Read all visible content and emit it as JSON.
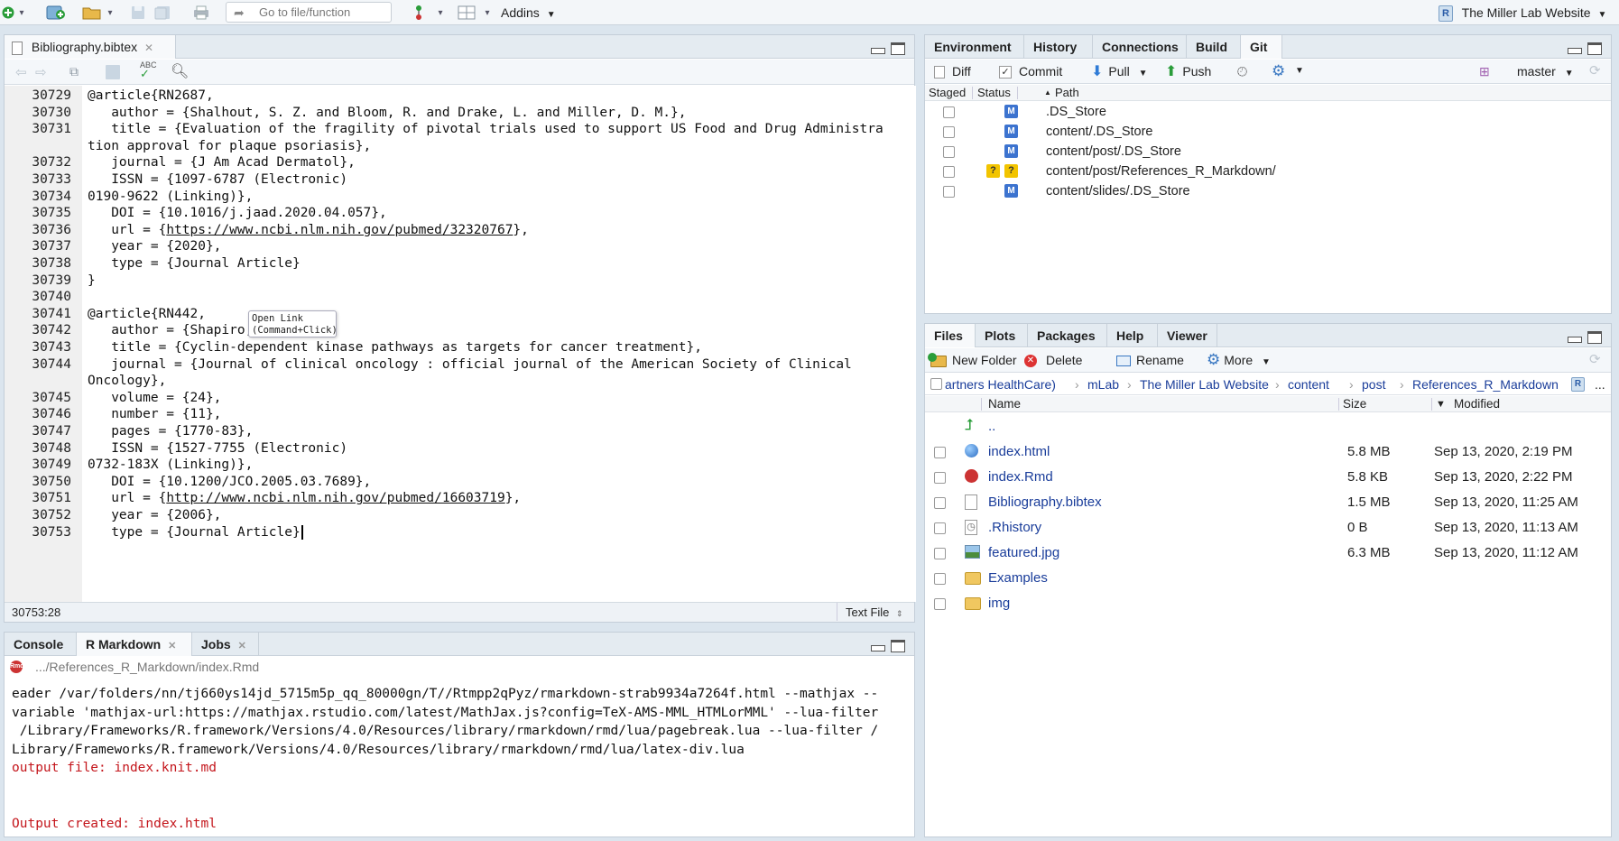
{
  "toolbar": {
    "goto_placeholder": "Go to file/function",
    "addins_label": "Addins",
    "project_label": "The Miller Lab Website"
  },
  "editor": {
    "tab_label": "Bibliography.bibtex",
    "lines": [
      {
        "num": "30729",
        "text": "@article{RN2687,"
      },
      {
        "num": "30730",
        "text": "   author = {Shalhout, S. Z. and Bloom, R. and Drake, L. and Miller, D. M.},"
      },
      {
        "num": "30731",
        "text": "   title = {Evaluation of the fragility of pivotal trials used to support US Food and Drug Administra"
      },
      {
        "num": "",
        "text": "tion approval for plaque psoriasis},"
      },
      {
        "num": "30732",
        "text": "   journal = {J Am Acad Dermatol},"
      },
      {
        "num": "30733",
        "text": "   ISSN = {1097-6787 (Electronic)"
      },
      {
        "num": "30734",
        "text": "0190-9622 (Linking)},"
      },
      {
        "num": "30735",
        "text": "   DOI = {10.1016/j.jaad.2020.04.057},"
      },
      {
        "num": "30736",
        "pre": "   url = {",
        "link": "https://www.ncbi.nlm.nih.gov/pubmed/32320767",
        "post": "},"
      },
      {
        "num": "30737",
        "text": "   year = {2020},"
      },
      {
        "num": "30738",
        "text": "   type = {Journal Article}"
      },
      {
        "num": "30739",
        "text": "}"
      },
      {
        "num": "30740",
        "text": ""
      },
      {
        "num": "30741",
        "text": "@article{RN442,"
      },
      {
        "num": "30742",
        "text": "   author = {Shapiro, G. I.},"
      },
      {
        "num": "30743",
        "text": "   title = {Cyclin-dependent kinase pathways as targets for cancer treatment},"
      },
      {
        "num": "30744",
        "text": "   journal = {Journal of clinical oncology : official journal of the American Society of Clinical"
      },
      {
        "num": "",
        "text": "Oncology},"
      },
      {
        "num": "30745",
        "text": "   volume = {24},"
      },
      {
        "num": "30746",
        "text": "   number = {11},"
      },
      {
        "num": "30747",
        "text": "   pages = {1770-83},"
      },
      {
        "num": "30748",
        "text": "   ISSN = {1527-7755 (Electronic)"
      },
      {
        "num": "30749",
        "text": "0732-183X (Linking)},"
      },
      {
        "num": "30750",
        "text": "   DOI = {10.1200/JCO.2005.03.7689},"
      },
      {
        "num": "30751",
        "pre": "   url = {",
        "link": "http://www.ncbi.nlm.nih.gov/pubmed/16603719",
        "post": "},"
      },
      {
        "num": "30752",
        "text": "   year = {2006},"
      },
      {
        "num": "30753",
        "text": "   type = {Journal Article}"
      }
    ],
    "tooltip_line1": "Open Link",
    "tooltip_line2": "(Command+Click)",
    "cursor_pos": "30753:28",
    "file_type": "Text File"
  },
  "console": {
    "tabs": [
      "Console",
      "R Markdown",
      "Jobs"
    ],
    "path": ".../References_R_Markdown/index.Rmd",
    "lines": [
      {
        "text": "eader /var/folders/nn/tj660ys14jd_5715m5p_qq_80000gn/T//Rtmpp2qPyz/rmarkdown-strab9934a7264f.html --mathjax --",
        "red": false
      },
      {
        "text": "variable 'mathjax-url:https://mathjax.rstudio.com/latest/MathJax.js?config=TeX-AMS-MML_HTMLorMML' --lua-filter",
        "red": false
      },
      {
        "text": " /Library/Frameworks/R.framework/Versions/4.0/Resources/library/rmarkdown/rmd/lua/pagebreak.lua --lua-filter /",
        "red": false
      },
      {
        "text": "Library/Frameworks/R.framework/Versions/4.0/Resources/library/rmarkdown/rmd/lua/latex-div.lua",
        "red": false
      },
      {
        "text": "output file: index.knit.md",
        "red": true
      },
      {
        "text": "",
        "red": false
      },
      {
        "text": "",
        "red": false
      },
      {
        "text": "Output created: index.html",
        "red": true
      }
    ]
  },
  "env": {
    "tabs": [
      "Environment",
      "History",
      "Connections",
      "Build",
      "Git"
    ],
    "buttons": {
      "diff": "Diff",
      "commit": "Commit",
      "pull": "Pull",
      "push": "Push",
      "branch": "master"
    },
    "headers": {
      "staged": "Staged",
      "status": "Status",
      "path": "Path"
    },
    "rows": [
      {
        "status": "M",
        "path": ".DS_Store"
      },
      {
        "status": "M",
        "path": "content/.DS_Store"
      },
      {
        "status": "M",
        "path": "content/post/.DS_Store"
      },
      {
        "status": "?",
        "path": "content/post/References_R_Markdown/"
      },
      {
        "status": "M",
        "path": "content/slides/.DS_Store"
      }
    ]
  },
  "files": {
    "tabs": [
      "Files",
      "Plots",
      "Packages",
      "Help",
      "Viewer"
    ],
    "buttons": {
      "new_folder": "New Folder",
      "delete": "Delete",
      "rename": "Rename",
      "more": "More"
    },
    "breadcrumbs": [
      "artners HealthCare)",
      "mLab",
      "The Miller Lab Website",
      "content",
      "post",
      "References_R_Markdown"
    ],
    "breadcrumb_more": "...",
    "headers": {
      "name": "Name",
      "size": "Size",
      "modified": "Modified"
    },
    "up_label": "..",
    "rows": [
      {
        "icon": "html-file-icon",
        "name": "index.html",
        "size": "5.8 MB",
        "modified": "Sep 13, 2020, 2:19 PM"
      },
      {
        "icon": "rmd-file-icon",
        "name": "index.Rmd",
        "size": "5.8 KB",
        "modified": "Sep 13, 2020, 2:22 PM"
      },
      {
        "icon": "text-file-icon",
        "name": "Bibliography.bibtex",
        "size": "1.5 MB",
        "modified": "Sep 13, 2020, 11:25 AM"
      },
      {
        "icon": "rhistory-file-icon",
        "name": ".Rhistory",
        "size": "0 B",
        "modified": "Sep 13, 2020, 11:13 AM"
      },
      {
        "icon": "image-file-icon",
        "name": "featured.jpg",
        "size": "6.3 MB",
        "modified": "Sep 13, 2020, 11:12 AM"
      },
      {
        "icon": "folder-icon",
        "name": "Examples",
        "size": "",
        "modified": ""
      },
      {
        "icon": "folder-icon",
        "name": "img",
        "size": "",
        "modified": ""
      }
    ]
  }
}
